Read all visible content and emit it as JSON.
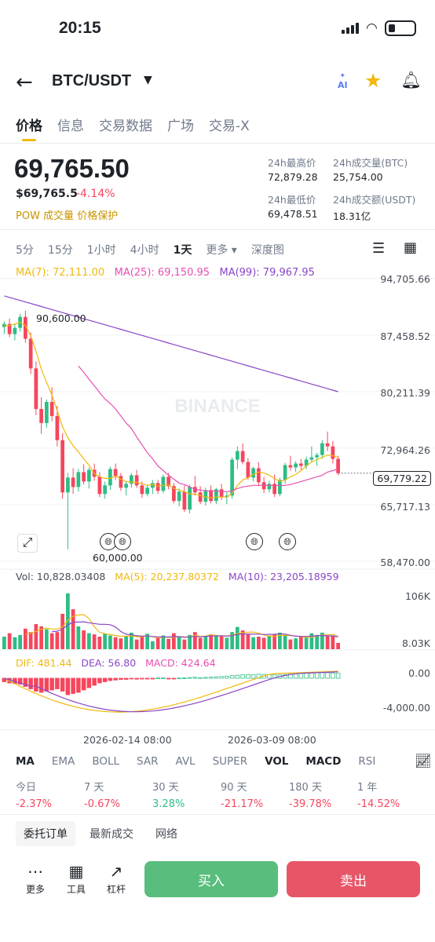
{
  "status_bar": {
    "time": "20:15"
  },
  "header": {
    "pair": "BTC/USDT",
    "ai_label": "AI"
  },
  "tabs": [
    "价格",
    "信息",
    "交易数据",
    "广场",
    "交易-X"
  ],
  "price": {
    "last": "69,765.50",
    "usd": "$69,765.5",
    "change": "-4.14%",
    "tags": "POW  成交量  价格保护"
  },
  "stats": {
    "high_label": "24h最高价",
    "high": "72,879.28",
    "vol_btc_label": "24h成交量(BTC)",
    "vol_btc": "25,754.00",
    "low_label": "24h最低价",
    "low": "69,478.51",
    "vol_usdt_label": "24h成交额(USDT)",
    "vol_usdt": "18.31亿"
  },
  "intervals": [
    "5分",
    "15分",
    "1小时",
    "4小时",
    "1天",
    "更多 ▾",
    "深度图"
  ],
  "ma": {
    "ma7": "MA(7): 72,111.00",
    "ma25": "MA(25): 69,150.95",
    "ma99": "MA(99): 79,967.95"
  },
  "price_axis": [
    "94,705.66",
    "87,458.52",
    "80,211.39",
    "72,964.26",
    "65,717.13",
    "58,470.00"
  ],
  "current_price_label": "69,779.22",
  "high_marker": "90,600.00",
  "low_marker": "60,000.00",
  "watermark": "BINANCE",
  "volume": {
    "vol": "Vol: 10,828.03408",
    "ma5": "MA(5): 20,237.80372",
    "ma10": "MA(10): 23,205.18959",
    "axis_top": "106K",
    "axis_bottom": "8.03K"
  },
  "macd": {
    "dif": "DIF: 481.44",
    "dea": "DEA: 56.80",
    "macd": "MACD: 424.64",
    "axis_top": "0.00",
    "axis_bottom": "-4,000.00"
  },
  "time_axis": [
    "2026-02-14 08:00",
    "2026-03-09 08:00"
  ],
  "indicators": [
    "MA",
    "EMA",
    "BOLL",
    "SAR",
    "AVL",
    "SUPER",
    "VOL",
    "MACD",
    "RSI"
  ],
  "performance": [
    {
      "label": "今日",
      "value": "-2.37%"
    },
    {
      "label": "7 天",
      "value": "-0.67%"
    },
    {
      "label": "30 天",
      "value": "3.28%"
    },
    {
      "label": "90 天",
      "value": "-21.17%"
    },
    {
      "label": "180 天",
      "value": "-39.78%"
    },
    {
      "label": "1 年",
      "value": "-14.52%"
    }
  ],
  "order_tabs": [
    "委托订单",
    "最新成交",
    "网络"
  ],
  "tools": [
    "更多",
    "工具",
    "杠杆"
  ],
  "buy_label": "买入",
  "sell_label": "卖出",
  "colors": {
    "up": "#2ebd85",
    "down": "#f6465d",
    "ma7": "#f0b90b",
    "ma25": "#e54fb1",
    "ma99": "#8a46c8",
    "accent": "#f0b90b"
  },
  "chart_data": {
    "type": "candlestick",
    "y_range": [
      58470,
      94705.66
    ],
    "candles": [
      [
        88500,
        89200,
        87600,
        88900
      ],
      [
        88900,
        89600,
        87200,
        87600
      ],
      [
        87600,
        88900,
        86800,
        88400
      ],
      [
        88400,
        90200,
        87900,
        89800
      ],
      [
        89800,
        90600,
        86500,
        87000
      ],
      [
        87000,
        87800,
        82500,
        83200
      ],
      [
        83200,
        84100,
        77200,
        78000
      ],
      [
        78000,
        79500,
        74800,
        76200
      ],
      [
        76200,
        79200,
        75600,
        78900
      ],
      [
        78900,
        80800,
        76400,
        77100
      ],
      [
        77100,
        78400,
        73200,
        74000
      ],
      [
        74000,
        74900,
        66500,
        67300
      ],
      [
        67300,
        69800,
        60000,
        69200
      ],
      [
        69200,
        70400,
        67100,
        68000
      ],
      [
        68000,
        70300,
        67400,
        69900
      ],
      [
        69900,
        70900,
        68300,
        68700
      ],
      [
        68700,
        70500,
        67800,
        70200
      ],
      [
        70200,
        71000,
        68800,
        69300
      ],
      [
        69300,
        69900,
        66700,
        67100
      ],
      [
        67100,
        68700,
        66500,
        68200
      ],
      [
        68200,
        70600,
        67600,
        70300
      ],
      [
        70300,
        71000,
        68900,
        69400
      ],
      [
        69400,
        69800,
        67500,
        67900
      ],
      [
        67900,
        68700,
        66900,
        68400
      ],
      [
        68400,
        69800,
        67900,
        69500
      ],
      [
        69500,
        70200,
        67900,
        68200
      ],
      [
        68200,
        68700,
        66600,
        67100
      ],
      [
        67100,
        68300,
        66800,
        67900
      ],
      [
        67900,
        68900,
        67100,
        68500
      ],
      [
        68500,
        68900,
        67100,
        67500
      ],
      [
        67500,
        69600,
        67200,
        69300
      ],
      [
        69300,
        69800,
        67700,
        68100
      ],
      [
        68100,
        68500,
        65900,
        66200
      ],
      [
        66200,
        67800,
        65500,
        67400
      ],
      [
        67400,
        68200,
        64800,
        65100
      ],
      [
        65100,
        68300,
        64600,
        68000
      ],
      [
        68000,
        69400,
        66900,
        67300
      ],
      [
        67300,
        68100,
        65800,
        66100
      ],
      [
        66100,
        67900,
        65600,
        67600
      ],
      [
        67600,
        68200,
        65900,
        66200
      ],
      [
        66200,
        67900,
        65800,
        67700
      ],
      [
        67700,
        68400,
        66300,
        66700
      ],
      [
        66700,
        67300,
        65800,
        66900
      ],
      [
        66900,
        71800,
        66500,
        71500
      ],
      [
        71500,
        73200,
        70300,
        72600
      ],
      [
        72600,
        73600,
        70900,
        71200
      ],
      [
        71200,
        71700,
        68900,
        69200
      ],
      [
        69200,
        70600,
        68700,
        70400
      ],
      [
        70400,
        71200,
        68100,
        68600
      ],
      [
        68600,
        69300,
        67200,
        67700
      ],
      [
        67700,
        68800,
        67300,
        68400
      ],
      [
        68400,
        69600,
        66700,
        67100
      ],
      [
        67100,
        69200,
        66800,
        68900
      ],
      [
        68900,
        71100,
        68400,
        70800
      ],
      [
        70800,
        72000,
        70100,
        70500
      ],
      [
        70500,
        71300,
        69900,
        71000
      ],
      [
        71000,
        71600,
        70200,
        70700
      ],
      [
        70700,
        71900,
        70300,
        71500
      ],
      [
        71500,
        73200,
        71100,
        71800
      ],
      [
        71800,
        72400,
        70700,
        72100
      ],
      [
        72100,
        74000,
        71600,
        73600
      ],
      [
        73600,
        75100,
        72600,
        73200
      ],
      [
        73200,
        73900,
        71000,
        71600
      ],
      [
        71600,
        72000,
        69500,
        69766
      ]
    ],
    "ma7": [
      88600,
      88700,
      88900,
      89100,
      88700,
      87400,
      85400,
      83100,
      81400,
      79800,
      77800,
      75700,
      74300,
      73300,
      72500,
      71600,
      70800,
      69700,
      69300,
      69100,
      69100,
      69400,
      69000,
      68700,
      68600,
      68600,
      68400,
      68200,
      68300,
      68100,
      68200,
      68300,
      67800,
      67600,
      67400,
      67100,
      67100,
      66900,
      66700,
      66600,
      66700,
      66700,
      66700,
      67200,
      68200,
      68900,
      69200,
      69600,
      69900,
      69800,
      69500,
      69100,
      68700,
      68900,
      69300,
      69600,
      70100,
      70700,
      71200,
      71500,
      71800,
      72100,
      72000,
      71800
    ],
    "ma25": [
      null,
      null,
      null,
      null,
      null,
      null,
      null,
      null,
      null,
      null,
      null,
      null,
      null,
      null,
      83500,
      82700,
      81800,
      81000,
      80100,
      79300,
      78700,
      78000,
      77100,
      76200,
      75500,
      74400,
      73400,
      72400,
      71600,
      70700,
      70100,
      69500,
      69000,
      68500,
      68300,
      68000,
      67700,
      67600,
      67500,
      67500,
      67500,
      67400,
      67400,
      67500,
      67800,
      68000,
      68100,
      68200,
      68200,
      68200,
      68200,
      68200,
      68200,
      68200,
      68300,
      68500,
      68700,
      68900,
      69100,
      69300,
      69500,
      69900,
      70100,
      70300
    ],
    "ma99": [
      null,
      null,
      null,
      null,
      null,
      null,
      null,
      null,
      null,
      null,
      null,
      null,
      null,
      null,
      null,
      null,
      null,
      null,
      null,
      null,
      null,
      null,
      null,
      null,
      null,
      null,
      null,
      null,
      null,
      null,
      null,
      null,
      null,
      null,
      null,
      null,
      null,
      null,
      null,
      null,
      null,
      null,
      null,
      null,
      null,
      null,
      null,
      null,
      null,
      null,
      null,
      null,
      null,
      null,
      null,
      null,
      null,
      null,
      null,
      null,
      null,
      null,
      null,
      79968
    ],
    "volumes_k": [
      22,
      28,
      21,
      25,
      36,
      30,
      44,
      40,
      35,
      28,
      30,
      62,
      98,
      70,
      40,
      33,
      28,
      26,
      22,
      27,
      24,
      21,
      19,
      23,
      29,
      17,
      22,
      27,
      14,
      20,
      24,
      18,
      28,
      21,
      17,
      25,
      30,
      20,
      23,
      26,
      23,
      24,
      20,
      30,
      39,
      33,
      27,
      21,
      22,
      20,
      24,
      26,
      29,
      24,
      17,
      19,
      22,
      21,
      28,
      25,
      29,
      23,
      24,
      11
    ],
    "macd_hist": [
      -300,
      -400,
      -450,
      -500,
      -700,
      -900,
      -1100,
      -1200,
      -1100,
      -1000,
      -900,
      -1100,
      -1400,
      -1300,
      -1200,
      -1000,
      -800,
      -600,
      -400,
      -300,
      -200,
      -150,
      -100,
      -100,
      -50,
      -80,
      -60,
      -40,
      -20,
      30,
      40,
      -20,
      -10,
      20,
      30,
      60,
      80,
      50,
      70,
      90,
      120,
      150,
      180,
      220,
      260,
      300,
      320,
      300,
      340,
      320,
      300,
      290,
      280,
      300,
      350,
      380,
      400,
      420,
      440,
      460,
      480,
      470,
      450,
      425
    ]
  }
}
